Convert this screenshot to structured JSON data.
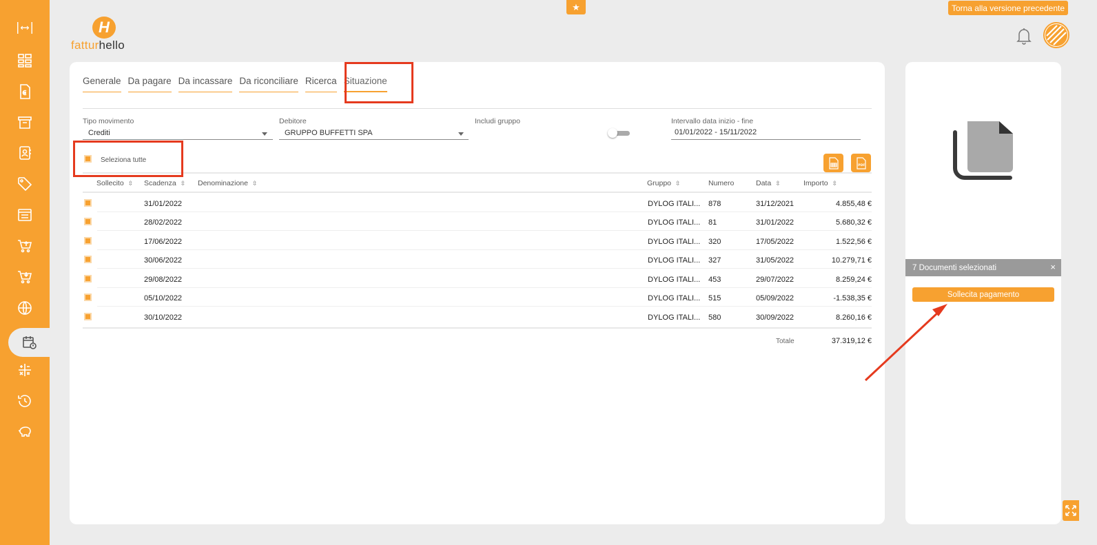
{
  "app": {
    "logo_part1": "fattur",
    "logo_part2": "hello",
    "logo_mark": "H",
    "prev_version_label": "Torna alla versione precedente",
    "colors": {
      "accent": "#f7a130",
      "highlight": "#e53a1e",
      "background": "#ececec"
    }
  },
  "sidebar": {
    "expand_label": "|⟷|",
    "items": [
      {
        "icon": "dashboard-icon"
      },
      {
        "icon": "invoice-euro-icon"
      },
      {
        "icon": "archive-icon"
      },
      {
        "icon": "contacts-icon"
      },
      {
        "icon": "tag-icon"
      },
      {
        "icon": "register-icon"
      },
      {
        "icon": "cart-out-icon"
      },
      {
        "icon": "cart-in-icon"
      },
      {
        "icon": "globe-icon"
      },
      {
        "icon": "payment-schedule-icon",
        "active": true
      },
      {
        "icon": "calculator-icon"
      },
      {
        "icon": "history-icon"
      },
      {
        "icon": "piggy-bank-icon"
      }
    ]
  },
  "tabs": [
    {
      "label": "Generale"
    },
    {
      "label": "Da pagare"
    },
    {
      "label": "Da incassare"
    },
    {
      "label": "Da riconciliare"
    },
    {
      "label": "Ricerca"
    },
    {
      "label": "Situazione",
      "active": true
    }
  ],
  "filters": {
    "tipo_label": "Tipo movimento",
    "tipo_value": "Crediti",
    "debitore_label": "Debitore",
    "debitore_value": "GRUPPO BUFFETTI SPA",
    "gruppo_label": "Includi gruppo",
    "gruppo_on": false,
    "intervallo_label": "Intervallo data inizio - fine",
    "intervallo_value": "01/01/2022 - 15/11/2022"
  },
  "select_all_label": "Seleziona tutte",
  "table": {
    "headers": {
      "sollecito": "Sollecito",
      "scadenza": "Scadenza",
      "denominazione": "Denominazione",
      "gruppo": "Gruppo",
      "numero": "Numero",
      "data": "Data",
      "importo": "Importo"
    },
    "rows": [
      {
        "scadenza": "31/01/2022",
        "gruppo": "DYLOG ITALI...",
        "numero": "878",
        "data": "31/12/2021",
        "importo": "4.855,48 €"
      },
      {
        "scadenza": "28/02/2022",
        "gruppo": "DYLOG ITALI...",
        "numero": "81",
        "data": "31/01/2022",
        "importo": "5.680,32 €"
      },
      {
        "scadenza": "17/06/2022",
        "gruppo": "DYLOG ITALI...",
        "numero": "320",
        "data": "17/05/2022",
        "importo": "1.522,56 €"
      },
      {
        "scadenza": "30/06/2022",
        "gruppo": "DYLOG ITALI...",
        "numero": "327",
        "data": "31/05/2022",
        "importo": "10.279,71 €"
      },
      {
        "scadenza": "29/08/2022",
        "gruppo": "DYLOG ITALI...",
        "numero": "453",
        "data": "29/07/2022",
        "importo": "8.259,24 €"
      },
      {
        "scadenza": "05/10/2022",
        "gruppo": "DYLOG ITALI...",
        "numero": "515",
        "data": "05/09/2022",
        "importo": "-1.538,35 €"
      },
      {
        "scadenza": "30/10/2022",
        "gruppo": "DYLOG ITALI...",
        "numero": "580",
        "data": "30/09/2022",
        "importo": "8.260,16 €"
      }
    ],
    "total_label": "Totale",
    "total_value": "37.319,12 €"
  },
  "right_panel": {
    "selected_label": "7 Documenti selezionati",
    "close_label": "×",
    "remind_button": "Sollecita pagamento"
  }
}
